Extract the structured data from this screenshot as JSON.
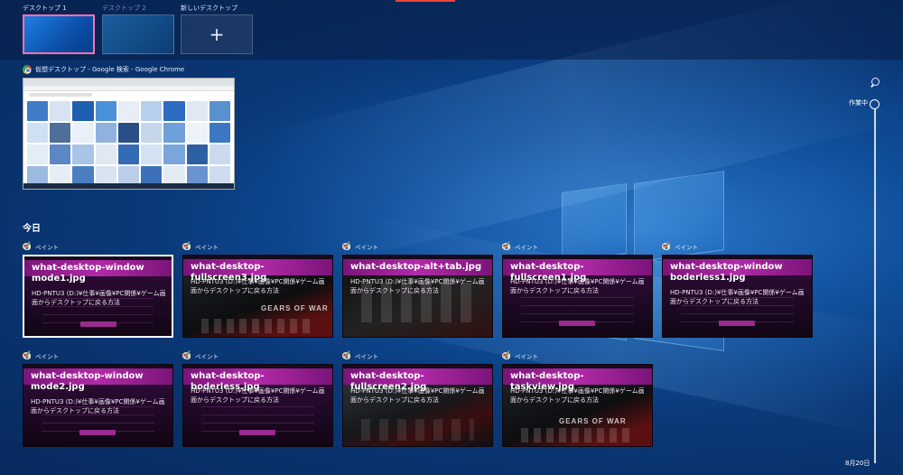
{
  "desktops": [
    {
      "label": "デスクトップ 1",
      "active": true
    },
    {
      "label": "デスクトップ 2",
      "active": false
    },
    {
      "label": "新しいデスクトップ",
      "add_glyph": "+"
    }
  ],
  "current_window": {
    "title": "仮想デスクトップ - Google 検索 - Google Chrome",
    "icon": "chrome-icon"
  },
  "timeline": {
    "section_label": "今日",
    "now_label": "作業中",
    "date_label": "8月20日",
    "search_icon": "search-icon",
    "cards": [
      {
        "app": "ペイント",
        "title": "what-desktop-window mode1.jpg",
        "desc": "HD-PNTU3 (D:)¥仕事¥画像¥PC関係¥ゲーム画面からデスクトップに戻る方法",
        "style": "purple",
        "selected": true
      },
      {
        "app": "ペイント",
        "title": "what-desktop-fullscreen3.jpg",
        "desc": "HD-PNTU3 (D:)¥仕事¥画像¥PC関係¥ゲーム画面からデスクトップに戻る方法",
        "style": "gears",
        "overlay": "GEARS OF WAR"
      },
      {
        "app": "ペイント",
        "title": "what-desktop-alt+tab.jpg",
        "desc": "HD-PNTU3 (D:)¥仕事¥画像¥PC関係¥ゲーム画面からデスクトップに戻る方法",
        "style": "dark"
      },
      {
        "app": "ペイント",
        "title": "what-desktop-fullscreen1.jpg",
        "desc": "HD-PNTU3 (D:)¥仕事¥画像¥PC関係¥ゲーム画面からデスクトップに戻る方法",
        "style": "purple"
      },
      {
        "app": "ペイント",
        "title": "what-desktop-window boderless1.jpg",
        "desc": "HD-PNTU3 (D:)¥仕事¥画像¥PC関係¥ゲーム画面からデスクトップに戻る方法",
        "style": "purple"
      },
      {
        "app": "ペイント",
        "title": "what-desktop-window mode2.jpg",
        "desc": "HD-PNTU3 (D:)¥仕事¥画像¥PC関係¥ゲーム画面からデスクトップに戻る方法",
        "style": "purple"
      },
      {
        "app": "ペイント",
        "title": "what-desktop-boderless.jpg",
        "desc": "HD-PNTU3 (D:)¥仕事¥画像¥PC関係¥ゲーム画面からデスクトップに戻る方法",
        "style": "purple"
      },
      {
        "app": "ペイント",
        "title": "what-desktop-fullscreen2.jpg",
        "desc": "HD-PNTU3 (D:)¥仕事¥画像¥PC関係¥ゲーム画面からデスクトップに戻る方法",
        "style": "gaming"
      },
      {
        "app": "ペイント",
        "title": "what-desktop-taskview.jpg",
        "desc": "HD-PNTU3 (D:)¥仕事¥画像¥PC関係¥ゲーム画面からデスクトップに戻る方法",
        "style": "gears",
        "overlay": "GEARS OF WAR"
      }
    ]
  },
  "colors": {
    "accent_pink": "#ff70b0",
    "accent_red": "#e8463c",
    "thumb_purple": "#b22aa8"
  }
}
